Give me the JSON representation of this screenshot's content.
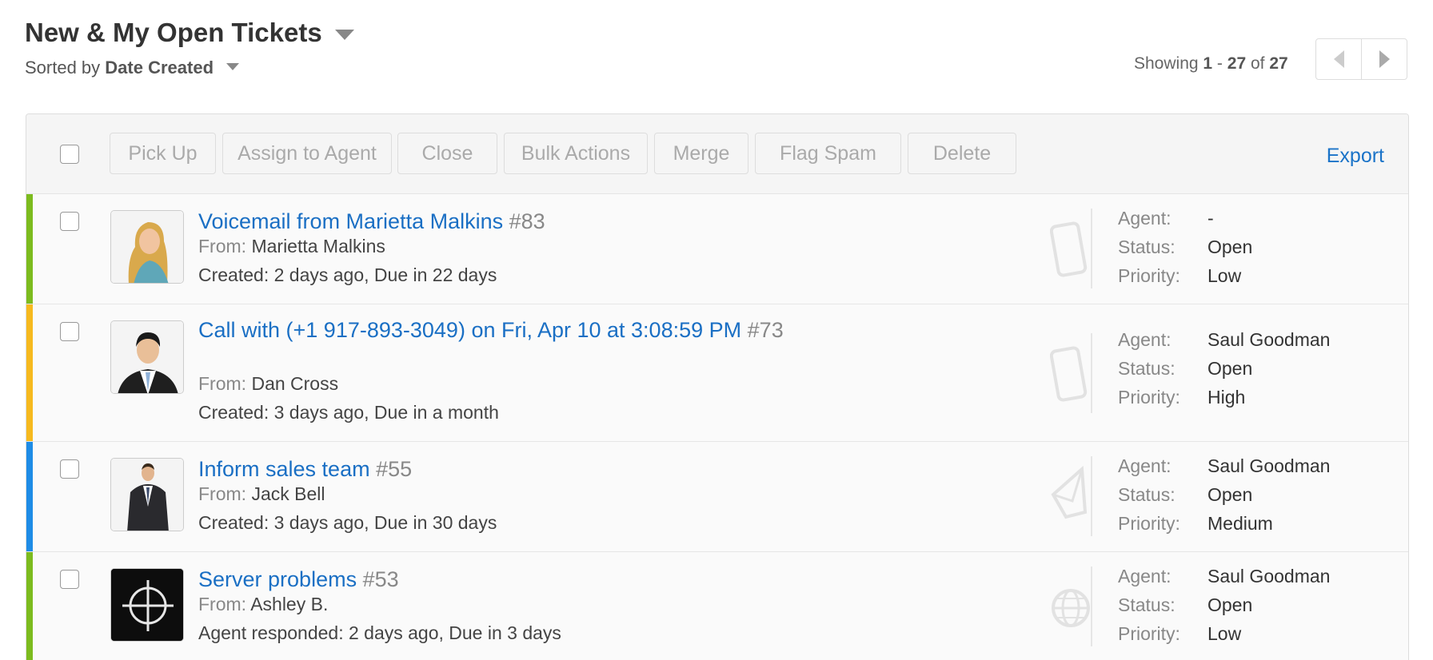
{
  "header": {
    "title": "New & My Open Tickets",
    "sorted_by_label": "Sorted by",
    "sorted_by_value": "Date Created"
  },
  "pager": {
    "showing_label": "Showing",
    "from": "1",
    "to": "27",
    "of_label": "of",
    "total": "27"
  },
  "toolbar": {
    "buttons": [
      "Pick Up",
      "Assign to Agent",
      "Close",
      "Bulk Actions",
      "Merge",
      "Flag Spam",
      "Delete"
    ],
    "export_label": "Export"
  },
  "labels": {
    "from": "From:",
    "agent": "Agent:",
    "status": "Status:",
    "priority": "Priority:"
  },
  "tickets": [
    {
      "subject": "Voicemail from Marietta Malkins",
      "number": "#83",
      "from": "Marietta Malkins",
      "timeline": "Created: 2 days ago, Due in 22 days",
      "agent": "-",
      "status": "Open",
      "priority": "Low",
      "color": "#7cbb1e",
      "channel_icon": "phone-icon"
    },
    {
      "subject": "Call with (+1 917-893-3049) on Fri, Apr 10 at 3:08:59 PM",
      "number": "#73",
      "from": "Dan Cross",
      "timeline": "Created: 3 days ago, Due in a month",
      "agent": "Saul Goodman",
      "status": "Open",
      "priority": "High",
      "color": "#f6b91e",
      "channel_icon": "phone-icon"
    },
    {
      "subject": "Inform sales team",
      "number": "#55",
      "from": "Jack Bell",
      "timeline": "Created: 3 days ago, Due in 30 days",
      "agent": "Saul Goodman",
      "status": "Open",
      "priority": "Medium",
      "color": "#1e8ce6",
      "channel_icon": "email-icon"
    },
    {
      "subject": "Server problems",
      "number": "#53",
      "from": "Ashley B.",
      "timeline": "Agent responded: 2 days ago, Due in 3 days",
      "agent": "Saul Goodman",
      "status": "Open",
      "priority": "Low",
      "color": "#7cbb1e",
      "channel_icon": "globe-icon"
    }
  ]
}
